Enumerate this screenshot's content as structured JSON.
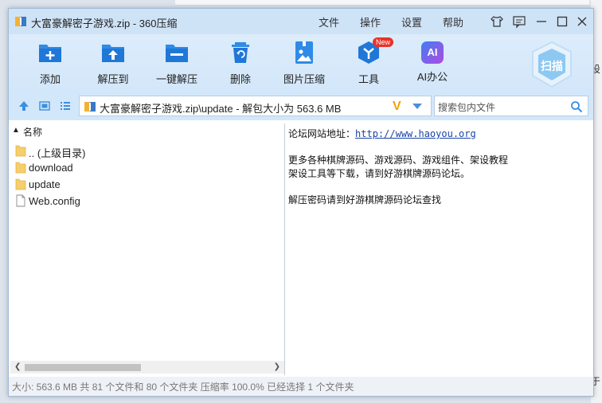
{
  "window": {
    "title": "大富豪解密子游戏.zip - 360压缩",
    "menu": [
      "文件",
      "操作",
      "设置",
      "帮助"
    ]
  },
  "toolbar": {
    "items": [
      {
        "label": "添加",
        "icon": "add-icon"
      },
      {
        "label": "解压到",
        "icon": "extract-to-icon"
      },
      {
        "label": "一键解压",
        "icon": "one-click-extract-icon"
      },
      {
        "label": "删除",
        "icon": "trash-icon"
      },
      {
        "label": "图片压缩",
        "icon": "image-compress-icon"
      },
      {
        "label": "工具",
        "icon": "tools-icon"
      },
      {
        "label": "AI办公",
        "icon": "ai-office-icon"
      }
    ],
    "tools_badge": "New",
    "ai_icon_text": "AI",
    "scan_label": "扫描"
  },
  "address": {
    "path": "大富豪解密子游戏.zip\\update - 解包大小为 563.6 MB",
    "v_logo": "V"
  },
  "search": {
    "placeholder": "搜索包内文件"
  },
  "file_list": {
    "column_name": "名称",
    "sort_arrow": "▲",
    "items": [
      {
        "name": ".. (上级目录)",
        "type": "folder"
      },
      {
        "name": "download",
        "type": "folder"
      },
      {
        "name": "update",
        "type": "folder"
      },
      {
        "name": "Web.config",
        "type": "file"
      }
    ]
  },
  "comment": {
    "site_label": "论坛网站地址：",
    "site_url": "http://www.haoyou.org",
    "line2": "更多各种棋牌源码、游戏源码、游戏组件、架设教程",
    "line3": "架设工具等下载，请到好游棋牌源码论坛。",
    "line4": "解压密码请到好游棋牌源码论坛查找"
  },
  "status": {
    "text": "大小: 563.6 MB 共 81 个文件和 80 个文件夹 压缩率 100.0% 已经选择 1 个文件夹"
  },
  "background": {
    "edge_text_1": "设",
    "edge_text_2": "于"
  },
  "colors": {
    "accent": "#2f8be6",
    "titlebar": "#cfe3f7",
    "toolbar": "#d3e7fa",
    "badge": "#e8332a"
  }
}
